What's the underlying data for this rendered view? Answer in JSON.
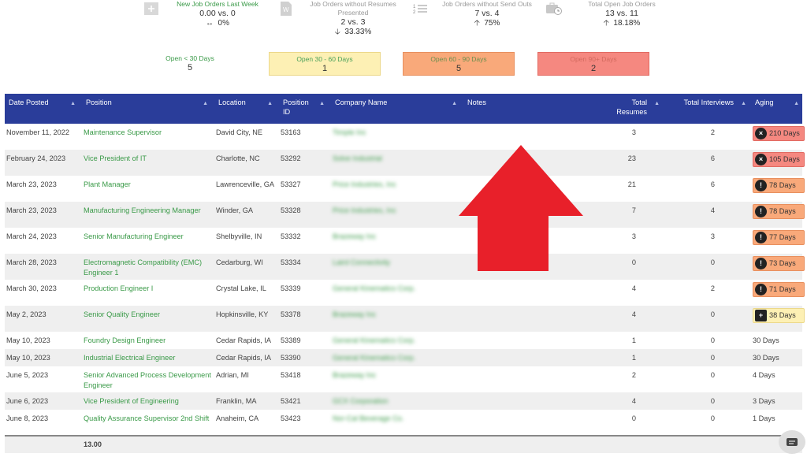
{
  "kpis": [
    {
      "title": "New Job Orders Last Week",
      "value": "0.00 vs. 0",
      "change": "0%",
      "change_icon": "neutral-arrows-icon"
    },
    {
      "title": "Job Orders without Resumes Presented",
      "value": "2 vs. 3",
      "change": "33.33%",
      "change_icon": "arrow-down-icon"
    },
    {
      "title": "Job Orders without Send Outs",
      "value": "7 vs. 4",
      "change": "75%",
      "change_icon": "arrow-up-icon"
    },
    {
      "title": "Total Open Job Orders",
      "value": "13 vs. 11",
      "change": "18.18%",
      "change_icon": "arrow-up-icon"
    }
  ],
  "buckets": [
    {
      "label": "Open < 30 Days",
      "value": "5"
    },
    {
      "label": "Open 30 - 60 Days",
      "value": "1"
    },
    {
      "label": "Open 60 - 90 Days",
      "value": "5"
    },
    {
      "label": "Open 90+ Days",
      "value": "2"
    }
  ],
  "columns": [
    "Date Posted",
    "Position",
    "Location",
    "Position ID",
    "Company Name",
    "Notes",
    "Total Resumes",
    "Total Interviews",
    "Aging"
  ],
  "rows": [
    {
      "date": "November 11, 2022",
      "position": "Maintenance Supervisor",
      "location": "David City, NE",
      "id": "53163",
      "company": "Timpte Inc",
      "resumes": "3",
      "interviews": "2",
      "aging": "210 Days",
      "aging_level": "red"
    },
    {
      "date": "February 24, 2023",
      "position": "Vice President of IT",
      "location": "Charlotte, NC",
      "id": "53292",
      "company": "Solve Industrial",
      "resumes": "23",
      "interviews": "6",
      "aging": "105 Days",
      "aging_level": "red"
    },
    {
      "date": "March 23, 2023",
      "position": "Plant Manager",
      "location": "Lawrenceville, GA",
      "id": "53327",
      "company": "Price Industries, Inc",
      "resumes": "21",
      "interviews": "6",
      "aging": "78 Days",
      "aging_level": "orange"
    },
    {
      "date": "March 23, 2023",
      "position": "Manufacturing Engineering Manager",
      "location": "Winder, GA",
      "id": "53328",
      "company": "Price Industries, Inc",
      "resumes": "7",
      "interviews": "4",
      "aging": "78 Days",
      "aging_level": "orange"
    },
    {
      "date": "March 24, 2023",
      "position": "Senior Manufacturing Engineer",
      "location": "Shelbyville, IN",
      "id": "53332",
      "company": "Brazeway Inc",
      "resumes": "3",
      "interviews": "3",
      "aging": "77 Days",
      "aging_level": "orange"
    },
    {
      "date": "March 28, 2023",
      "position": "Electromagnetic Compatibility (EMC) Engineer 1",
      "location": "Cedarburg, WI",
      "id": "53334",
      "company": "Laird Connectivity",
      "resumes": "0",
      "interviews": "0",
      "aging": "73 Days",
      "aging_level": "orange"
    },
    {
      "date": "March 30, 2023",
      "position": "Production Engineer I",
      "location": "Crystal Lake, IL",
      "id": "53339",
      "company": "General Kinematics Corp.",
      "resumes": "4",
      "interviews": "2",
      "aging": "71 Days",
      "aging_level": "orange"
    },
    {
      "date": "May 2, 2023",
      "position": "Senior Quality Engineer",
      "location": "Hopkinsville, KY",
      "id": "53378",
      "company": "Brazeway Inc",
      "resumes": "4",
      "interviews": "0",
      "aging": "38 Days",
      "aging_level": "yellow"
    },
    {
      "date": "May 10, 2023",
      "position": "Foundry Design Engineer",
      "location": "Cedar Rapids, IA",
      "id": "53389",
      "company": "General Kinematics Corp.",
      "resumes": "1",
      "interviews": "0",
      "aging": "30 Days",
      "aging_level": "none"
    },
    {
      "date": "May 10, 2023",
      "position": "Industrial Electrical Engineer",
      "location": "Cedar Rapids, IA",
      "id": "53390",
      "company": "General Kinematics Corp.",
      "resumes": "1",
      "interviews": "0",
      "aging": "30 Days",
      "aging_level": "none"
    },
    {
      "date": "June 5, 2023",
      "position": "Senior Advanced Process Development Engineer",
      "location": "Adrian, MI",
      "id": "53418",
      "company": "Brazeway Inc",
      "resumes": "2",
      "interviews": "0",
      "aging": "4 Days",
      "aging_level": "none"
    },
    {
      "date": "June 6, 2023",
      "position": "Vice President of Engineering",
      "location": "Franklin, MA",
      "id": "53421",
      "company": "GCX Corporation",
      "resumes": "4",
      "interviews": "0",
      "aging": "3 Days",
      "aging_level": "none"
    },
    {
      "date": "June 8, 2023",
      "position": "Quality Assurance Supervisor 2nd Shift",
      "location": "Anaheim, CA",
      "id": "53423",
      "company": "Nor-Cal Beverage Co.",
      "resumes": "0",
      "interviews": "0",
      "aging": "1 Days",
      "aging_level": "none"
    }
  ],
  "footer": {
    "position_total": "13.00"
  },
  "colors": {
    "header_bg": "#2a3d9a",
    "link_green": "#3a9a48",
    "aging_red": "#f58880",
    "aging_orange": "#f9a97a",
    "aging_yellow": "#fdf0b4",
    "arrow_red": "#e8202a"
  }
}
